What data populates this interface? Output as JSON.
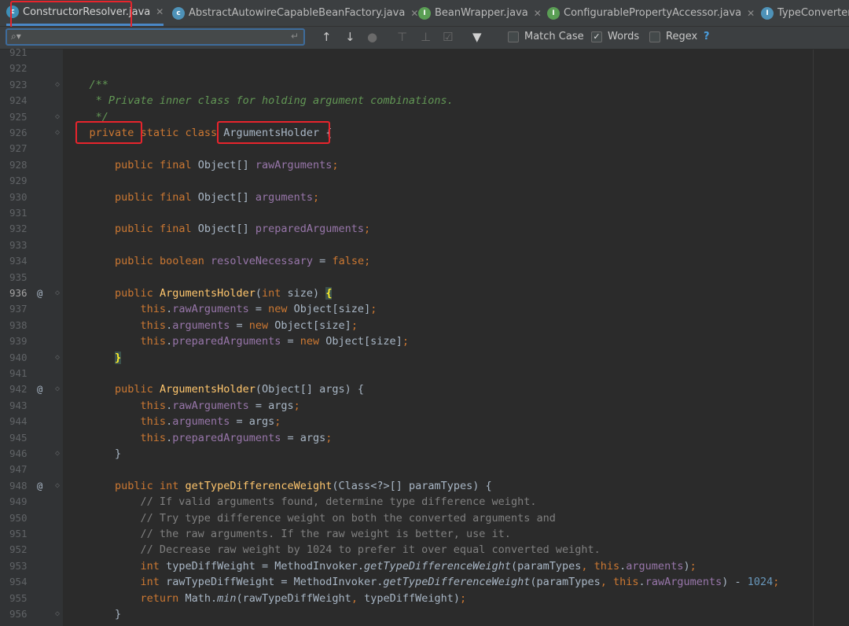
{
  "tabs": [
    {
      "label": "ConstructorResolver.java",
      "icon": "class-icon",
      "active": true
    },
    {
      "label": "AbstractAutowireCapableBeanFactory.java",
      "icon": "class-icon",
      "active": false
    },
    {
      "label": "BeanWrapper.java",
      "icon": "interface-icon",
      "active": false
    },
    {
      "label": "ConfigurablePropertyAccessor.java",
      "icon": "interface-icon",
      "active": false
    },
    {
      "label": "TypeConverter",
      "icon": "interface-icon",
      "active": false
    }
  ],
  "search": {
    "value": "",
    "options": [
      {
        "label": "Match Case",
        "checked": false
      },
      {
        "label": "Words",
        "checked": true
      },
      {
        "label": "Regex",
        "checked": false
      }
    ],
    "help": "?"
  },
  "lines": [
    {
      "n": "921",
      "tokens": []
    },
    {
      "n": "922",
      "tokens": []
    },
    {
      "n": "923",
      "fold": "⌃",
      "tokens": [
        [
          "    /**",
          "doc"
        ]
      ]
    },
    {
      "n": "924",
      "tokens": [
        [
          "     * Private inner class for holding argument combinations.",
          "doc"
        ]
      ]
    },
    {
      "n": "925",
      "fold": "⌄",
      "tokens": [
        [
          "     */",
          "doc"
        ]
      ]
    },
    {
      "n": "926",
      "fold": "⌃",
      "tokens": [
        [
          "    ",
          ""
        ],
        [
          "private",
          "kw"
        ],
        [
          " ",
          ""
        ],
        [
          "static",
          "kw"
        ],
        [
          " ",
          ""
        ],
        [
          "class",
          "kw"
        ],
        [
          " ArgumentsHolder {",
          ""
        ]
      ]
    },
    {
      "n": "927",
      "tokens": []
    },
    {
      "n": "928",
      "tokens": [
        [
          "        ",
          ""
        ],
        [
          "public",
          "kw"
        ],
        [
          " ",
          ""
        ],
        [
          "final",
          "kw"
        ],
        [
          " Object[] ",
          ""
        ],
        [
          "rawArguments",
          "fld"
        ],
        [
          ";",
          "kw"
        ]
      ]
    },
    {
      "n": "929",
      "tokens": []
    },
    {
      "n": "930",
      "tokens": [
        [
          "        ",
          ""
        ],
        [
          "public",
          "kw"
        ],
        [
          " ",
          ""
        ],
        [
          "final",
          "kw"
        ],
        [
          " Object[] ",
          ""
        ],
        [
          "arguments",
          "fld"
        ],
        [
          ";",
          "kw"
        ]
      ]
    },
    {
      "n": "931",
      "tokens": []
    },
    {
      "n": "932",
      "tokens": [
        [
          "        ",
          ""
        ],
        [
          "public",
          "kw"
        ],
        [
          " ",
          ""
        ],
        [
          "final",
          "kw"
        ],
        [
          " Object[] ",
          ""
        ],
        [
          "preparedArguments",
          "fld"
        ],
        [
          ";",
          "kw"
        ]
      ]
    },
    {
      "n": "933",
      "tokens": []
    },
    {
      "n": "934",
      "tokens": [
        [
          "        ",
          ""
        ],
        [
          "public",
          "kw"
        ],
        [
          " ",
          ""
        ],
        [
          "boolean",
          "kw"
        ],
        [
          " ",
          ""
        ],
        [
          "resolveNecessary",
          "fld"
        ],
        [
          " = ",
          ""
        ],
        [
          "false",
          "kw"
        ],
        [
          ";",
          "kw"
        ]
      ]
    },
    {
      "n": "935",
      "tokens": []
    },
    {
      "n": "936",
      "cur": true,
      "marker": "@",
      "fold": "⌃",
      "tokens": [
        [
          "        ",
          ""
        ],
        [
          "public",
          "kw"
        ],
        [
          " ",
          ""
        ],
        [
          "ArgumentsHolder",
          "fn"
        ],
        [
          "(",
          ""
        ],
        [
          "int",
          "kw"
        ],
        [
          " size) ",
          ""
        ],
        [
          "{",
          "brhl"
        ]
      ]
    },
    {
      "n": "937",
      "tokens": [
        [
          "            ",
          ""
        ],
        [
          "this",
          "kw"
        ],
        [
          ".",
          ""
        ],
        [
          "rawArguments",
          "fld"
        ],
        [
          " = ",
          ""
        ],
        [
          "new",
          "kw"
        ],
        [
          " Object[size]",
          ""
        ],
        [
          ";",
          "kw"
        ]
      ]
    },
    {
      "n": "938",
      "tokens": [
        [
          "            ",
          ""
        ],
        [
          "this",
          "kw"
        ],
        [
          ".",
          ""
        ],
        [
          "arguments",
          "fld"
        ],
        [
          " = ",
          ""
        ],
        [
          "new",
          "kw"
        ],
        [
          " Object[size]",
          ""
        ],
        [
          ";",
          "kw"
        ]
      ]
    },
    {
      "n": "939",
      "tokens": [
        [
          "            ",
          ""
        ],
        [
          "this",
          "kw"
        ],
        [
          ".",
          ""
        ],
        [
          "preparedArguments",
          "fld"
        ],
        [
          " = ",
          ""
        ],
        [
          "new",
          "kw"
        ],
        [
          " Object[size]",
          ""
        ],
        [
          ";",
          "kw"
        ]
      ]
    },
    {
      "n": "940",
      "fold": "⌄",
      "tokens": [
        [
          "        ",
          ""
        ],
        [
          "}",
          "brhl"
        ]
      ]
    },
    {
      "n": "941",
      "tokens": []
    },
    {
      "n": "942",
      "marker": "@",
      "fold": "⌃",
      "tokens": [
        [
          "        ",
          ""
        ],
        [
          "public",
          "kw"
        ],
        [
          " ",
          ""
        ],
        [
          "ArgumentsHolder",
          "fn"
        ],
        [
          "(Object[] args) {",
          ""
        ]
      ]
    },
    {
      "n": "943",
      "tokens": [
        [
          "            ",
          ""
        ],
        [
          "this",
          "kw"
        ],
        [
          ".",
          ""
        ],
        [
          "rawArguments",
          "fld"
        ],
        [
          " = args",
          ""
        ],
        [
          ";",
          "kw"
        ]
      ]
    },
    {
      "n": "944",
      "tokens": [
        [
          "            ",
          ""
        ],
        [
          "this",
          "kw"
        ],
        [
          ".",
          ""
        ],
        [
          "arguments",
          "fld"
        ],
        [
          " = args",
          ""
        ],
        [
          ";",
          "kw"
        ]
      ]
    },
    {
      "n": "945",
      "tokens": [
        [
          "            ",
          ""
        ],
        [
          "this",
          "kw"
        ],
        [
          ".",
          ""
        ],
        [
          "preparedArguments",
          "fld"
        ],
        [
          " = args",
          ""
        ],
        [
          ";",
          "kw"
        ]
      ]
    },
    {
      "n": "946",
      "fold": "⌄",
      "tokens": [
        [
          "        }",
          ""
        ]
      ]
    },
    {
      "n": "947",
      "tokens": []
    },
    {
      "n": "948",
      "marker": "@",
      "fold": "⌃",
      "tokens": [
        [
          "        ",
          ""
        ],
        [
          "public",
          "kw"
        ],
        [
          " ",
          ""
        ],
        [
          "int",
          "kw"
        ],
        [
          " ",
          ""
        ],
        [
          "getTypeDifferenceWeight",
          "fn"
        ],
        [
          "(Class<?>[] paramTypes) {",
          ""
        ]
      ]
    },
    {
      "n": "949",
      "tokens": [
        [
          "            // If valid arguments found, determine type difference weight.",
          "cm"
        ]
      ]
    },
    {
      "n": "950",
      "tokens": [
        [
          "            // Try type difference weight on both the converted arguments and",
          "cm"
        ]
      ]
    },
    {
      "n": "951",
      "tokens": [
        [
          "            // the raw arguments. If the raw weight is better, use it.",
          "cm"
        ]
      ]
    },
    {
      "n": "952",
      "tokens": [
        [
          "            // Decrease raw weight by 1024 to prefer it over equal converted weight.",
          "cm"
        ]
      ]
    },
    {
      "n": "953",
      "tokens": [
        [
          "            ",
          ""
        ],
        [
          "int",
          "kw"
        ],
        [
          " typeDiffWeight = MethodInvoker.",
          ""
        ],
        [
          "getTypeDifferenceWeight",
          "it"
        ],
        [
          "(paramTypes",
          ""
        ],
        [
          ", ",
          "kw"
        ],
        [
          "this",
          "kw"
        ],
        [
          ".",
          ""
        ],
        [
          "arguments",
          "fld"
        ],
        [
          ")",
          ""
        ],
        [
          ";",
          "kw"
        ]
      ]
    },
    {
      "n": "954",
      "tokens": [
        [
          "            ",
          ""
        ],
        [
          "int",
          "kw"
        ],
        [
          " rawTypeDiffWeight = MethodInvoker.",
          ""
        ],
        [
          "getTypeDifferenceWeight",
          "it"
        ],
        [
          "(paramTypes",
          ""
        ],
        [
          ", ",
          "kw"
        ],
        [
          "this",
          "kw"
        ],
        [
          ".",
          ""
        ],
        [
          "rawArguments",
          "fld"
        ],
        [
          ") - ",
          ""
        ],
        [
          "1024",
          "num"
        ],
        [
          ";",
          "kw"
        ]
      ]
    },
    {
      "n": "955",
      "tokens": [
        [
          "            ",
          ""
        ],
        [
          "return",
          "kw"
        ],
        [
          " Math.",
          ""
        ],
        [
          "min",
          "it"
        ],
        [
          "(rawTypeDiffWeight",
          ""
        ],
        [
          ", ",
          "kw"
        ],
        [
          "typeDiffWeight)",
          ""
        ],
        [
          ";",
          "kw"
        ]
      ]
    },
    {
      "n": "956",
      "fold": "⌄",
      "tokens": [
        [
          "        }",
          ""
        ]
      ]
    }
  ]
}
